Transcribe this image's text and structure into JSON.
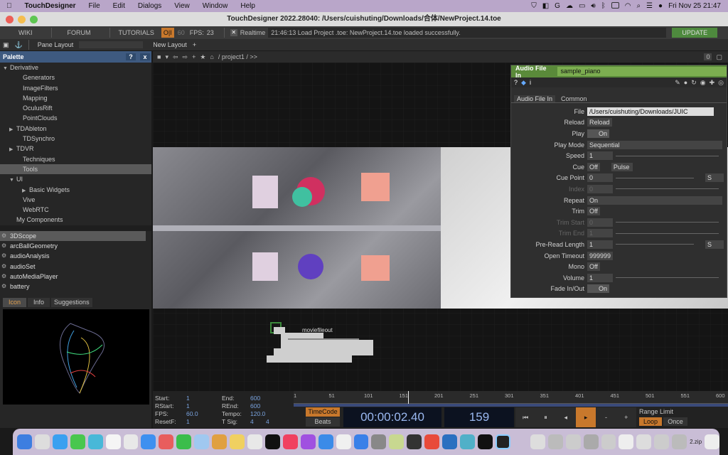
{
  "menubar": {
    "apple": "",
    "app": "TouchDesigner",
    "items": [
      "File",
      "Edit",
      "Dialogs",
      "View",
      "Window",
      "Help"
    ],
    "clock": "Fri Nov 25  21:47"
  },
  "window": {
    "title": "TouchDesigner 2022.28040: /Users/cuishuting/Downloads/合体/NewProject.14.toe"
  },
  "toolbar": {
    "wiki": "WIKI",
    "forum": "FORUM",
    "tutorials": "TUTORIALS",
    "oi": "O|I",
    "fps_target": "60",
    "fps_label": "FPS:",
    "fps_value": "23",
    "realtime": "Realtime",
    "status": "21:46:13 Load Project .toe: NewProject.14.toe loaded successfully.",
    "update": "UPDATE"
  },
  "toolbar2": {
    "pane_layout": "Pane Layout",
    "new_layout": "New Layout"
  },
  "palette": {
    "title": "Palette",
    "help": "?",
    "close": "x",
    "tree": [
      {
        "label": "Derivative",
        "indent": 0,
        "arrow": "▼"
      },
      {
        "label": "Generators",
        "indent": 2,
        "arrow": ""
      },
      {
        "label": "ImageFilters",
        "indent": 2,
        "arrow": ""
      },
      {
        "label": "Mapping",
        "indent": 2,
        "arrow": ""
      },
      {
        "label": "OculusRift",
        "indent": 2,
        "arrow": ""
      },
      {
        "label": "PointClouds",
        "indent": 2,
        "arrow": ""
      },
      {
        "label": "TDAbleton",
        "indent": 1,
        "arrow": "▶"
      },
      {
        "label": "TDSynchro",
        "indent": 2,
        "arrow": ""
      },
      {
        "label": "TDVR",
        "indent": 1,
        "arrow": "▶"
      },
      {
        "label": "Techniques",
        "indent": 2,
        "arrow": ""
      },
      {
        "label": "Tools",
        "indent": 2,
        "arrow": "",
        "selected": true
      },
      {
        "label": "UI",
        "indent": 1,
        "arrow": "▼"
      },
      {
        "label": "Basic Widgets",
        "indent": 3,
        "arrow": "▶"
      },
      {
        "label": "Vive",
        "indent": 2,
        "arrow": ""
      },
      {
        "label": "WebRTC",
        "indent": 2,
        "arrow": ""
      },
      {
        "label": "My Components",
        "indent": 1,
        "arrow": ""
      }
    ],
    "components": [
      "3DScope",
      "arcBallGeometry",
      "audioAnalysis",
      "audioSet",
      "autoMediaPlayer",
      "battery"
    ],
    "tabs": [
      "Icon",
      "Info",
      "Suggestions"
    ]
  },
  "pathbar": {
    "path": "/ project1 / >>",
    "count": "0"
  },
  "params": {
    "type": "Audio File In",
    "name": "sample_piano",
    "tabs": [
      "Audio File In",
      "Common"
    ],
    "rows": [
      {
        "label": "File",
        "value": "/Users/cuishuting/Downloads/JUIC"
      },
      {
        "label": "Reload",
        "value": "Reload"
      },
      {
        "label": "Play",
        "value": "On"
      },
      {
        "label": "Play Mode",
        "value": "Sequential"
      },
      {
        "label": "Speed",
        "value": "1"
      },
      {
        "label": "Cue",
        "value": "Off",
        "extra": "Pulse"
      },
      {
        "label": "Cue Point",
        "value": "0",
        "unit": "S"
      },
      {
        "label": "Index",
        "value": "0",
        "disabled": true
      },
      {
        "label": "Repeat",
        "value": "On"
      },
      {
        "label": "Trim",
        "value": "Off"
      },
      {
        "label": "Trim Start",
        "value": "0",
        "disabled": true
      },
      {
        "label": "Trim End",
        "value": "1",
        "disabled": true
      },
      {
        "label": "Pre-Read Length",
        "value": "1",
        "unit": "S"
      },
      {
        "label": "Open Timeout",
        "value": "999999"
      },
      {
        "label": "Mono",
        "value": "Off"
      },
      {
        "label": "Volume",
        "value": "1"
      },
      {
        "label": "Fade In/Out",
        "value": "On"
      }
    ]
  },
  "network": {
    "node_label": "moviefileout"
  },
  "timeline": {
    "start_l": "Start:",
    "start": "1",
    "rstart_l": "RStart:",
    "rstart": "1",
    "fps_l": "FPS:",
    "fps": "60.0",
    "resetf_l": "ResetF:",
    "resetf": "1",
    "end_l": "End:",
    "end": "600",
    "rend_l": "REnd:",
    "rend": "600",
    "tempo_l": "Tempo:",
    "tempo": "120.0",
    "tsig_l": "T Sig:",
    "tsig_a": "4",
    "tsig_b": "4",
    "ticks": [
      "1",
      "51",
      "101",
      "151",
      "201",
      "251",
      "301",
      "351",
      "401",
      "451",
      "501",
      "551",
      "600"
    ],
    "timecode_btn": "TimeCode",
    "beats_btn": "Beats",
    "timecode": "00:00:02.40",
    "frame": "159",
    "range_label": "Range Limit",
    "loop": "Loop",
    "once": "Once"
  },
  "dock": {
    "zip_label": "2.zip"
  }
}
